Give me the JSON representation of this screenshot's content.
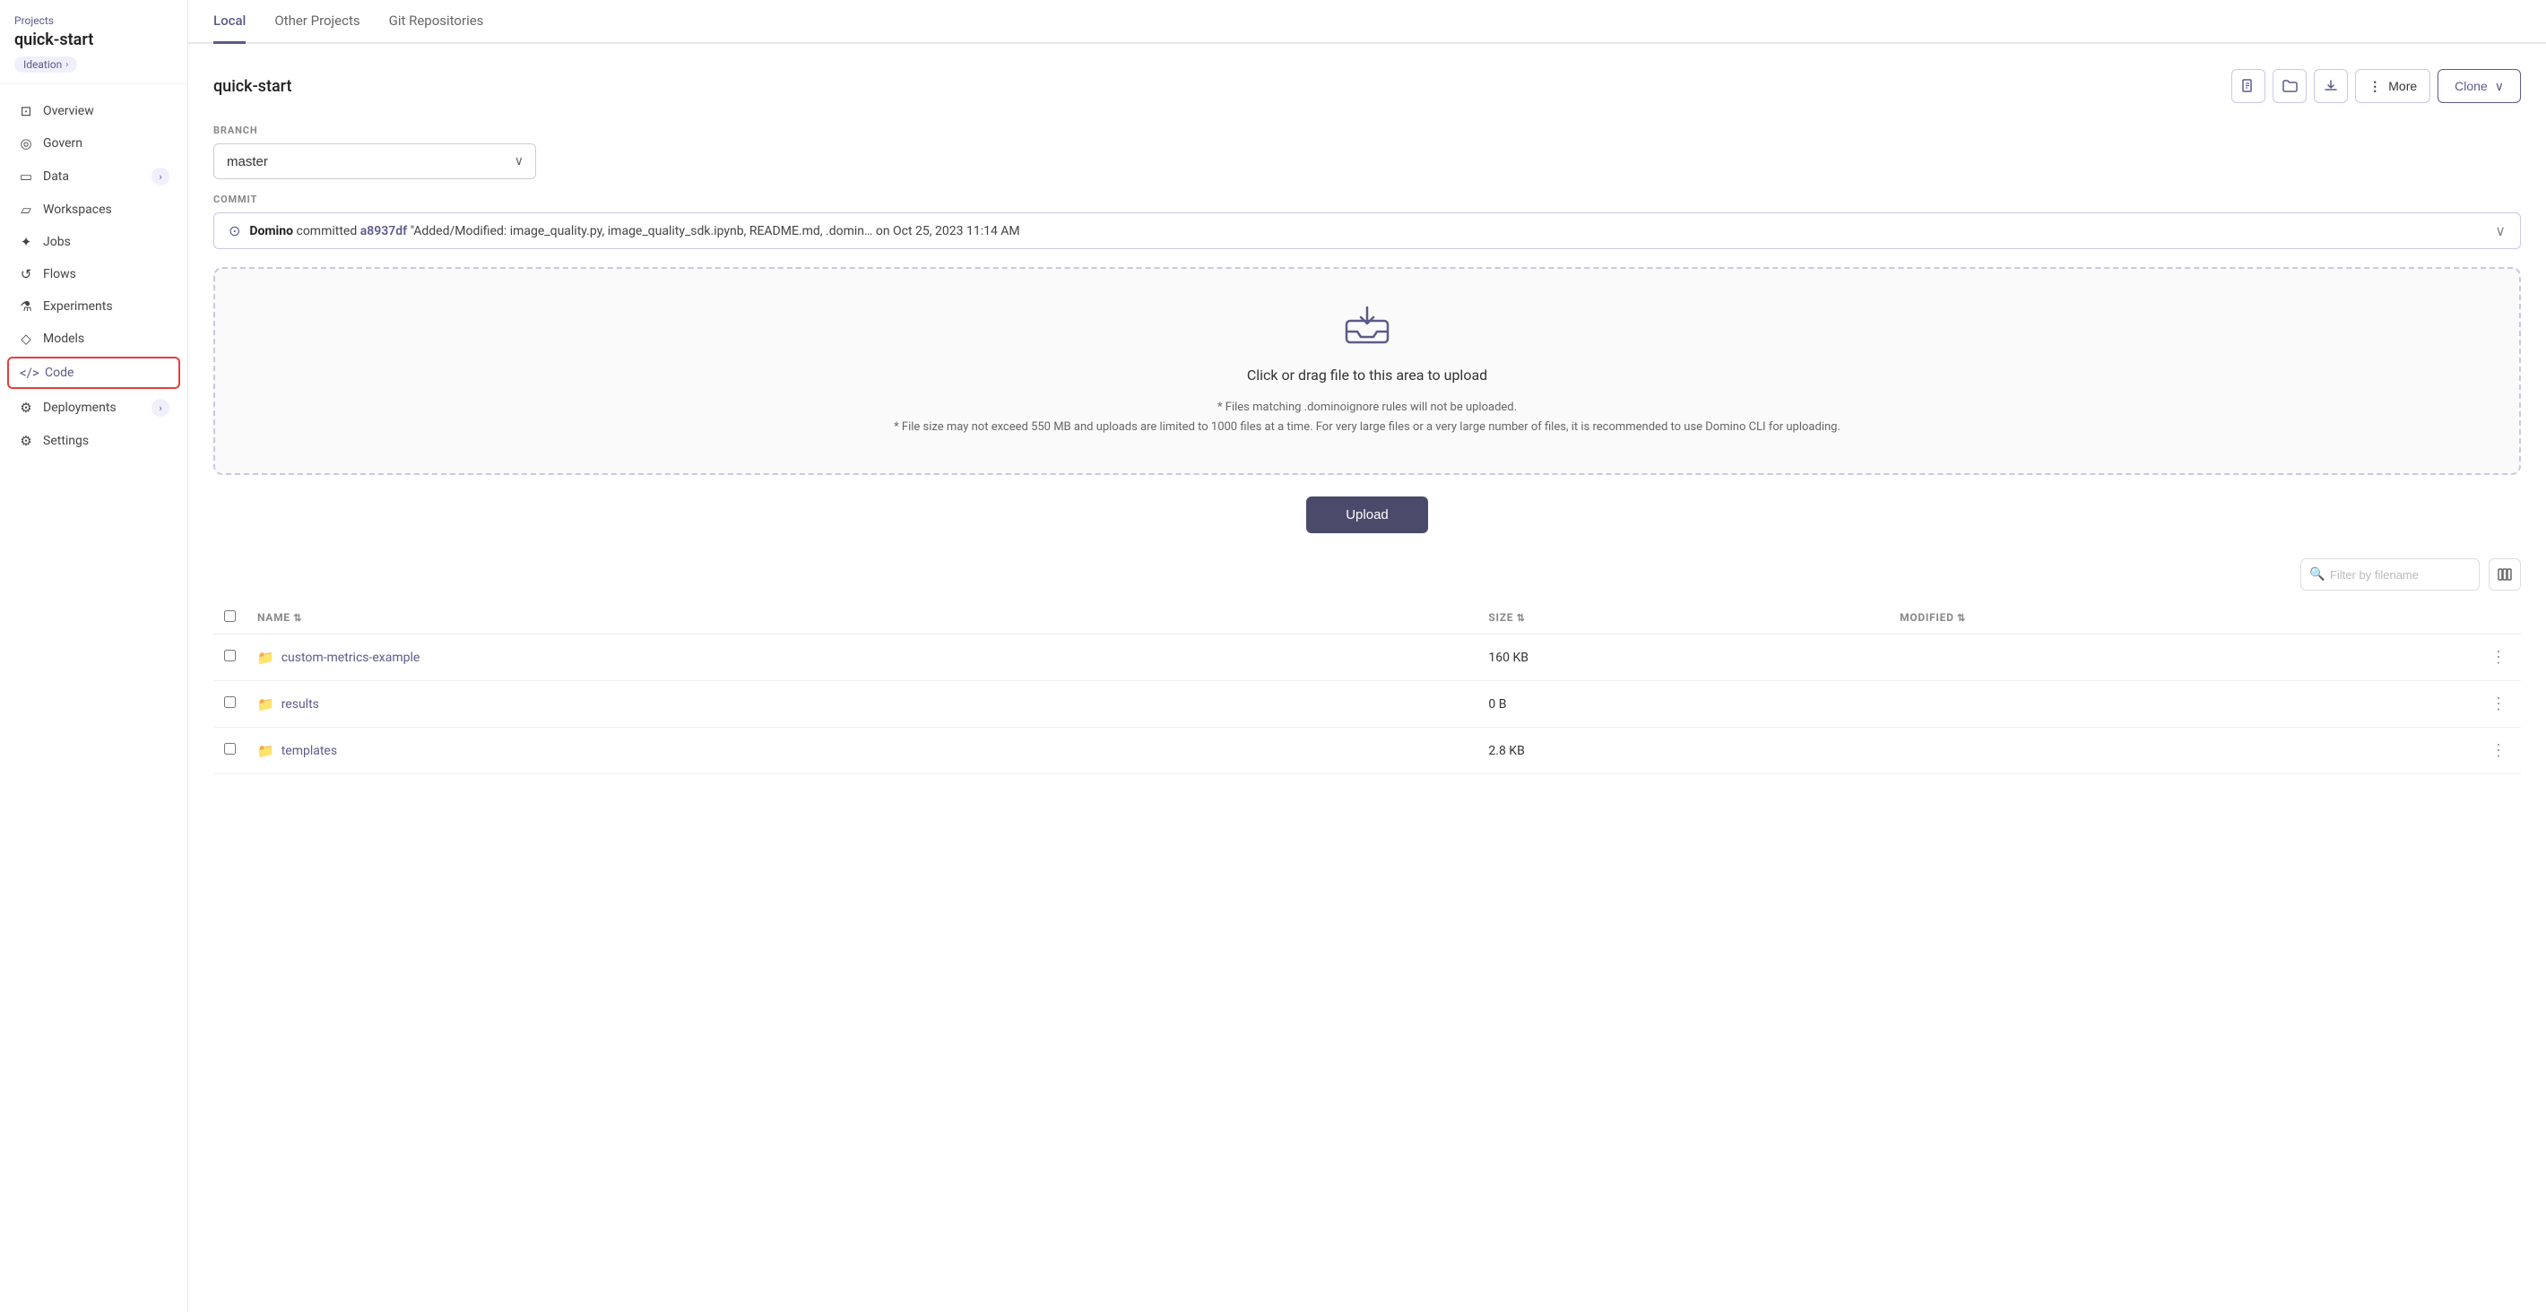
{
  "sidebar": {
    "projects_link": "Projects",
    "project_name": "quick-start",
    "tag": "Ideation",
    "tag_chevron": "›",
    "nav_items": [
      {
        "id": "overview",
        "label": "Overview",
        "icon": "⊡",
        "badge": null,
        "active": false
      },
      {
        "id": "govern",
        "label": "Govern",
        "icon": "◎",
        "badge": null,
        "active": false
      },
      {
        "id": "data",
        "label": "Data",
        "icon": "▭",
        "badge": "›",
        "active": false
      },
      {
        "id": "workspaces",
        "label": "Workspaces",
        "icon": "▱",
        "badge": null,
        "active": false
      },
      {
        "id": "jobs",
        "label": "Jobs",
        "icon": "✦",
        "badge": null,
        "active": false
      },
      {
        "id": "flows",
        "label": "Flows",
        "icon": "↺",
        "badge": null,
        "active": false
      },
      {
        "id": "experiments",
        "label": "Experiments",
        "icon": "⚗",
        "badge": null,
        "active": false
      },
      {
        "id": "models",
        "label": "Models",
        "icon": "◇",
        "badge": null,
        "active": false
      },
      {
        "id": "code",
        "label": "Code",
        "icon": "</>",
        "badge": null,
        "active": true
      },
      {
        "id": "deployments",
        "label": "Deployments",
        "icon": "⚙",
        "badge": "›",
        "active": false
      },
      {
        "id": "settings",
        "label": "Settings",
        "icon": "⚙",
        "badge": null,
        "active": false
      }
    ]
  },
  "tabs": [
    {
      "id": "local",
      "label": "Local",
      "active": true
    },
    {
      "id": "other-projects",
      "label": "Other Projects",
      "active": false
    },
    {
      "id": "git-repositories",
      "label": "Git Repositories",
      "active": false
    }
  ],
  "content": {
    "title": "quick-start",
    "actions": {
      "more_label": "More",
      "clone_label": "Clone"
    },
    "branch_label": "BRANCH",
    "branch_value": "master",
    "commit_label": "COMMIT",
    "commit": {
      "author": "Domino",
      "action": "committed",
      "hash": "a8937df",
      "message": "\"Added/Modified: image_quality.py, image_quality_sdk.ipynb, README.md, .domin…",
      "date": "on Oct 25, 2023 11:14 AM"
    },
    "upload_area": {
      "main_text": "Click or drag file to this area to upload",
      "note1": "* Files matching .dominoignore rules will not be uploaded.",
      "note2": "* File size may not exceed 550 MB and uploads are limited to 1000 files at a time. For very large files or a very large number of files, it is recommended to use Domino CLI for uploading."
    },
    "upload_btn_label": "Upload",
    "filter_placeholder": "Filter by filename",
    "table": {
      "headers": [
        {
          "id": "name",
          "label": "NAME",
          "sortable": true
        },
        {
          "id": "size",
          "label": "SIZE",
          "sortable": true
        },
        {
          "id": "modified",
          "label": "MODIFIED",
          "sortable": true
        }
      ],
      "rows": [
        {
          "name": "custom-metrics-example",
          "type": "folder",
          "size": "160 KB",
          "modified": ""
        },
        {
          "name": "results",
          "type": "folder",
          "size": "0 B",
          "modified": ""
        },
        {
          "name": "templates",
          "type": "folder",
          "size": "2.8 KB",
          "modified": ""
        }
      ]
    }
  },
  "colors": {
    "accent": "#5b5b8a",
    "active_border": "#e53e3e"
  }
}
